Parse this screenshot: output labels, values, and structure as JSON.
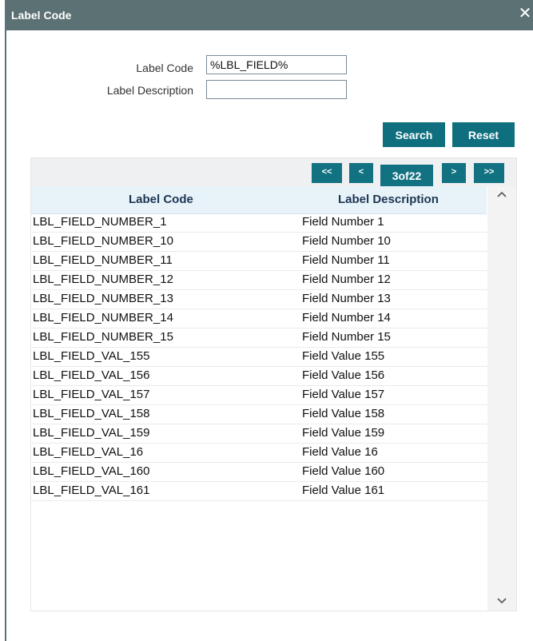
{
  "dialog": {
    "title": "Label Code",
    "close_glyph": "✕"
  },
  "form": {
    "label_code_label": "Label Code",
    "label_code_value": "%LBL_FIELD%",
    "label_desc_label": "Label Description",
    "label_desc_value": ""
  },
  "actions": {
    "search": "Search",
    "reset": "Reset"
  },
  "pager": {
    "first": "<<",
    "prev": "<",
    "indicator": "3of22",
    "next": ">",
    "last": ">>"
  },
  "table": {
    "headers": [
      "Label Code",
      "Label Description"
    ],
    "rows": [
      [
        "LBL_FIELD_NUMBER_1",
        "Field Number 1"
      ],
      [
        "LBL_FIELD_NUMBER_10",
        "Field Number 10"
      ],
      [
        "LBL_FIELD_NUMBER_11",
        "Field Number 11"
      ],
      [
        "LBL_FIELD_NUMBER_12",
        "Field Number 12"
      ],
      [
        "LBL_FIELD_NUMBER_13",
        "Field Number 13"
      ],
      [
        "LBL_FIELD_NUMBER_14",
        "Field Number 14"
      ],
      [
        "LBL_FIELD_NUMBER_15",
        "Field Number 15"
      ],
      [
        "LBL_FIELD_VAL_155",
        "Field Value 155"
      ],
      [
        "LBL_FIELD_VAL_156",
        "Field Value 156"
      ],
      [
        "LBL_FIELD_VAL_157",
        "Field Value 157"
      ],
      [
        "LBL_FIELD_VAL_158",
        "Field Value 158"
      ],
      [
        "LBL_FIELD_VAL_159",
        "Field Value 159"
      ],
      [
        "LBL_FIELD_VAL_16",
        "Field Value 16"
      ],
      [
        "LBL_FIELD_VAL_160",
        "Field Value 160"
      ],
      [
        "LBL_FIELD_VAL_161",
        "Field Value 161"
      ]
    ]
  },
  "colors": {
    "titlebar": "#5b7173",
    "accent": "#127282",
    "header_bg": "#e8f3f9"
  }
}
